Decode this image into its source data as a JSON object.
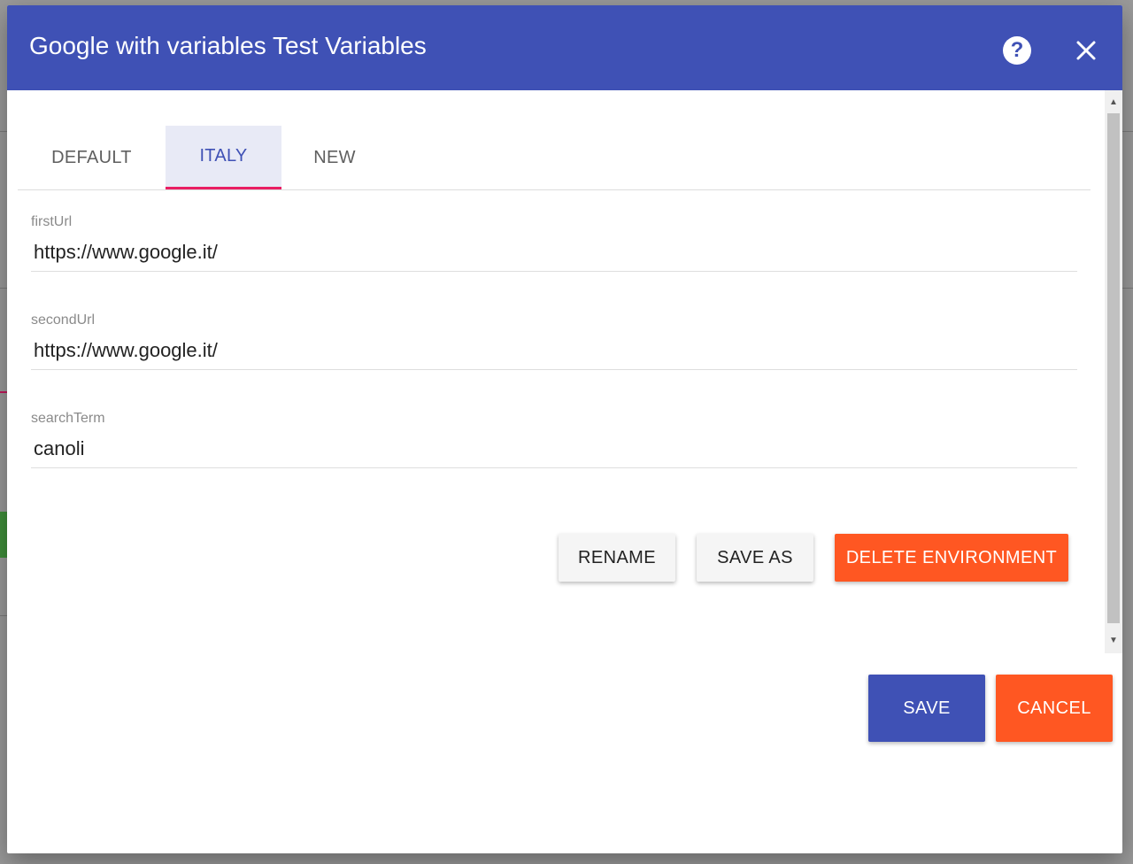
{
  "dialog": {
    "title": "Google with variables Test Variables",
    "help_icon": "help-icon",
    "close_icon": "close-icon"
  },
  "tabs": [
    {
      "label": "DEFAULT",
      "active": false
    },
    {
      "label": "ITALY",
      "active": true
    },
    {
      "label": "NEW",
      "active": false
    }
  ],
  "fields": [
    {
      "label": "firstUrl",
      "value": "https://www.google.it/"
    },
    {
      "label": "secondUrl",
      "value": "https://www.google.it/"
    },
    {
      "label": "searchTerm",
      "value": "canoli"
    }
  ],
  "environment_actions": {
    "rename_label": "RENAME",
    "save_as_label": "SAVE AS",
    "delete_label": "DELETE ENVIRONMENT"
  },
  "footer": {
    "save_label": "SAVE",
    "cancel_label": "CANCEL"
  },
  "colors": {
    "header": "#3f51b5",
    "accent_orange": "#ff5722",
    "tab_indicator": "#e91e63",
    "active_tab_bg": "#e8eaf6"
  }
}
